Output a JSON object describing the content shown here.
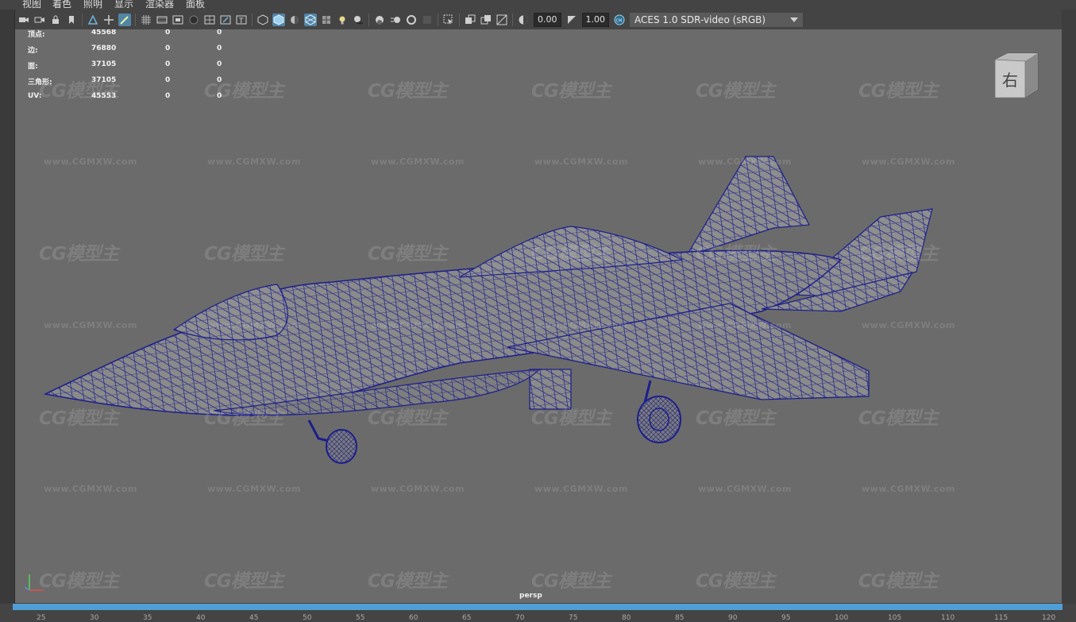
{
  "menu": {
    "items": [
      "视图",
      "着色",
      "照明",
      "显示",
      "渲染器",
      "面板"
    ]
  },
  "toolbar": {
    "icons": [
      "camera-icon",
      "select-camera-icon",
      "lock-camera-icon",
      "bookmark-icon",
      "image-plane-icon",
      "grease-pencil-icon",
      "grid-icon",
      "film-gate-icon",
      "resolution-gate-icon",
      "safe-area-icon",
      "field-chart-icon",
      "safe-title-icon",
      "wireframe-icon",
      "smooth-shade-icon",
      "default-material-icon",
      "wireframe-on-shaded-icon",
      "textured-icon",
      "lights-icon",
      "shadows-icon",
      "ambient-occlusion-icon",
      "motion-blur-icon",
      "anti-aliasing-icon",
      "depth-of-field-icon",
      "xray-icon",
      "isolate-select-icon",
      "xray-joints-icon",
      "xray-active-icon",
      "backface-icon",
      "exposure-icon",
      "gamma-icon",
      "color-management-icon"
    ],
    "exposure_value": "0.00",
    "gamma_value": "1.00",
    "color_transform": "ACES 1.0 SDR-video (sRGB)"
  },
  "hud": {
    "rows": [
      {
        "label": "顶点:",
        "v1": "45568",
        "v2": "0",
        "v3": "0"
      },
      {
        "label": "边:",
        "v1": "76880",
        "v2": "0",
        "v3": "0"
      },
      {
        "label": "面:",
        "v1": "37105",
        "v2": "0",
        "v3": "0"
      },
      {
        "label": "三角形:",
        "v1": "37105",
        "v2": "0",
        "v3": "0"
      },
      {
        "label": "UV:",
        "v1": "45553",
        "v2": "0",
        "v3": "0"
      }
    ]
  },
  "viewcube": {
    "face_label": "右"
  },
  "camera_label": "persp",
  "watermark": {
    "logo": "CG模型主",
    "url": "www.CGMXW.com"
  },
  "colors": {
    "viewport_bg": "#6b6b6b",
    "wireframe": "#1c1f8a",
    "timeline": "#4f9ed6",
    "active_icon": "#5285a6"
  },
  "timeline_ticks": [
    "25",
    "30",
    "35",
    "40",
    "45",
    "50",
    "55",
    "60",
    "65",
    "70",
    "75",
    "80",
    "85",
    "90",
    "95",
    "100",
    "105",
    "110",
    "115",
    "120"
  ]
}
